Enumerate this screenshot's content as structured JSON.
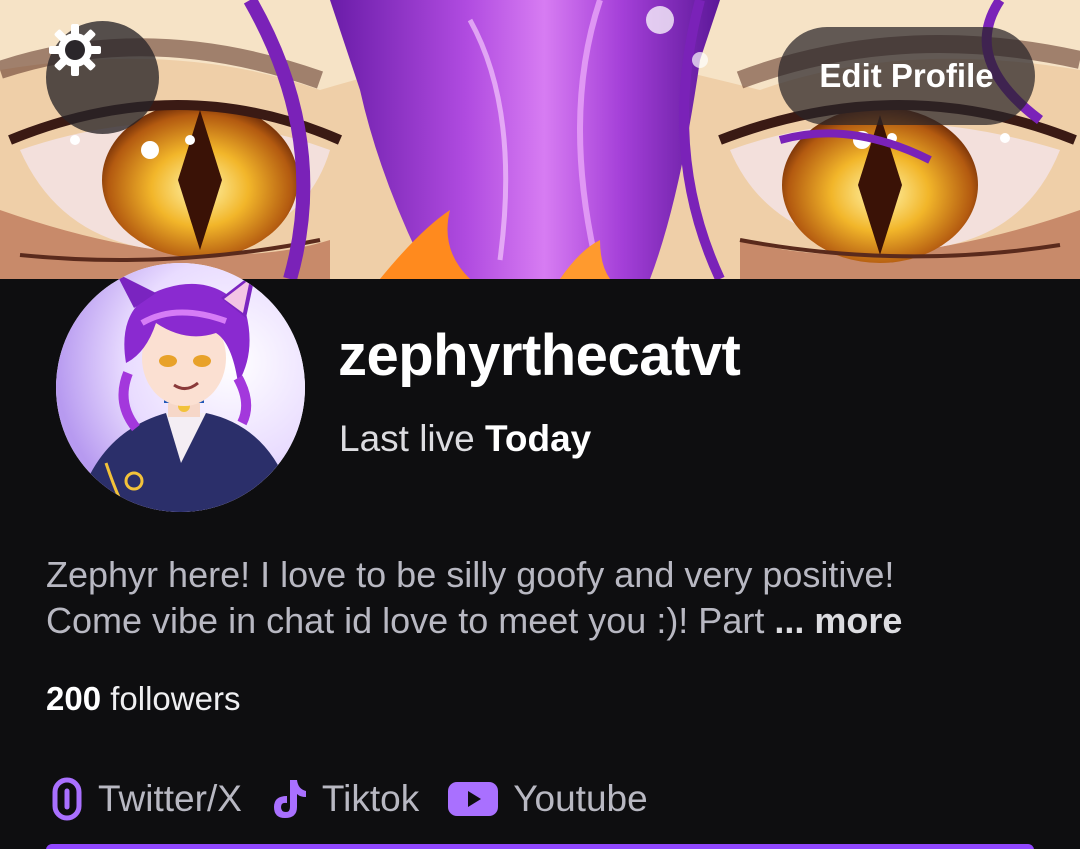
{
  "banner": {
    "settings_icon": "gear-icon",
    "edit_profile_label": "Edit Profile"
  },
  "profile": {
    "username": "zephyrthecatvt",
    "last_live_label": "Last live",
    "last_live_value": "Today"
  },
  "bio": {
    "line1": "Zephyr here! I love to be silly goofy and very positive!",
    "line2": "Come vibe in chat id love to meet you :)! Part",
    "ellipsis": "...",
    "more_label": "more"
  },
  "followers": {
    "count": "200",
    "label": "followers"
  },
  "socials": [
    {
      "icon": "link-icon",
      "label": "Twitter/X"
    },
    {
      "icon": "tiktok-icon",
      "label": "Tiktok"
    },
    {
      "icon": "youtube-icon",
      "label": "Youtube"
    }
  ],
  "colors": {
    "background": "#0e0e10",
    "accent": "#9147ff",
    "text_primary": "#ffffff",
    "text_secondary": "#b8b8c2"
  }
}
